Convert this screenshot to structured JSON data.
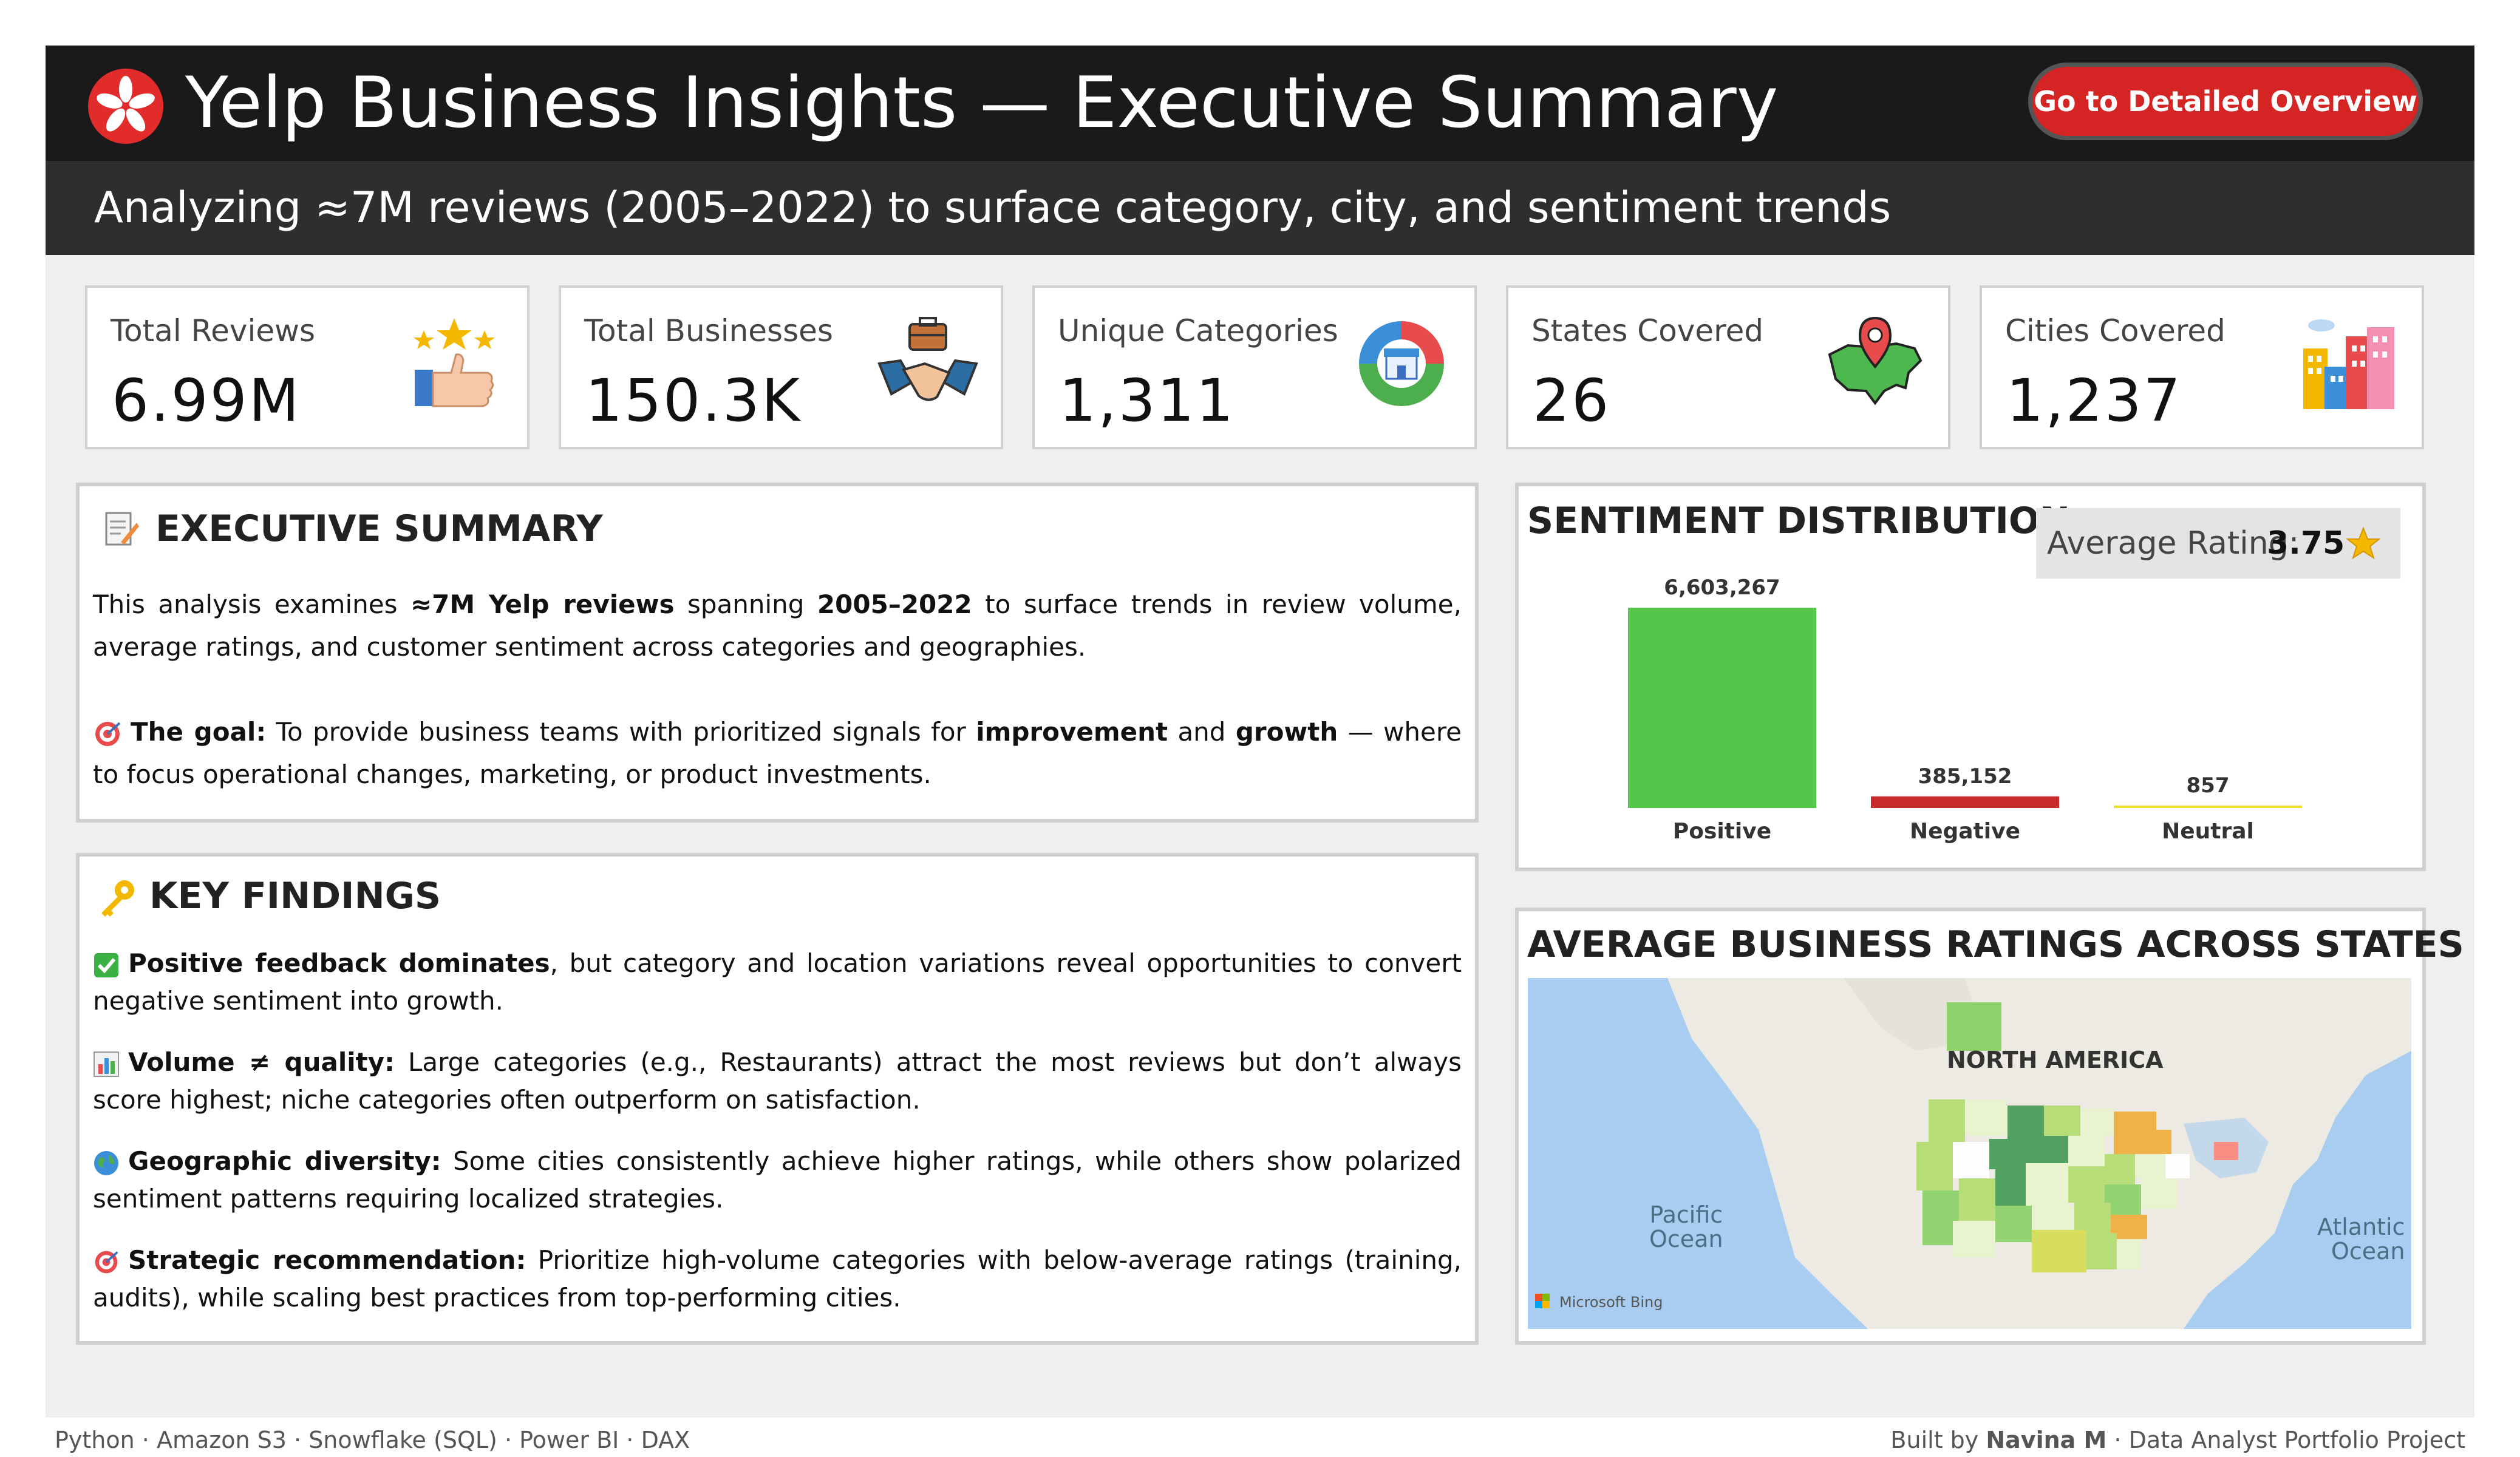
{
  "header": {
    "logo": "yelp-burst-logo",
    "title": "Yelp Business Insights — Executive Summary",
    "cta_label": "Go to Detailed Overview",
    "subtitle": "Analyzing ≈7M reviews (2005–2022) to surface category, city, and sentiment trends"
  },
  "kpis": [
    {
      "label": "Total Reviews",
      "value": "6.99M",
      "icon": "thumbs-up-stars-icon"
    },
    {
      "label": "Total Businesses",
      "value": "150.3K",
      "icon": "handshake-briefcase-icon"
    },
    {
      "label": "Unique Categories",
      "value": "1,311",
      "icon": "category-store-ring-icon"
    },
    {
      "label": "States Covered",
      "value": "26",
      "icon": "usa-map-pin-icon"
    },
    {
      "label": "Cities Covered",
      "value": "1,237",
      "icon": "city-buildings-icon"
    }
  ],
  "executive_summary": {
    "icon": "memo-pencil-icon",
    "title": "EXECUTIVE SUMMARY",
    "p1_a": "This analysis examines ",
    "p1_b": "≈7M Yelp reviews",
    "p1_c": " spanning ",
    "p1_d": "2005–2022",
    "p1_e": " to surface trends in review volume, average ratings, and customer sentiment across categories and geographies.",
    "goal_icon": "target-icon",
    "goal_label": "The goal:",
    "goal_a": " To provide business teams with prioritized signals for ",
    "goal_b": "improvement",
    "goal_c": " and ",
    "goal_d": "growth",
    "goal_e": " — where to focus operational changes, marketing, or product investments."
  },
  "key_findings": {
    "icon": "key-icon",
    "title": "KEY FINDINGS",
    "items": [
      {
        "icon": "check-icon",
        "bold": "Positive feedback dominates",
        "text": ", but category and location variations reveal opportunities to convert negative sentiment into growth."
      },
      {
        "icon": "bar-chart-icon",
        "bold": "Volume ≠ quality:",
        "text": " Large categories (e.g., Restaurants) attract the most reviews but don’t always score highest; niche categories often outperform on satisfaction."
      },
      {
        "icon": "globe-icon",
        "bold": "Geographic diversity:",
        "text": " Some cities consistently achieve higher ratings, while others show polarized sentiment patterns requiring localized strategies."
      },
      {
        "icon": "target-icon",
        "bold": "Strategic recommendation:",
        "text": " Prioritize high-volume categories with below-average ratings (training, audits), while scaling best practices from top-performing cities."
      }
    ]
  },
  "sentiment": {
    "title": "SENTIMENT DISTRIBUTION",
    "avg_label": "Average Rating:",
    "avg_value": "3.75",
    "avg_icon": "star-icon"
  },
  "chart_data": {
    "type": "bar",
    "title": "SENTIMENT DISTRIBUTION",
    "categories": [
      "Positive",
      "Negative",
      "Neutral"
    ],
    "values": [
      6603267,
      385152,
      857
    ],
    "value_labels": [
      "6,603,267",
      "385,152",
      "857"
    ],
    "colors": [
      "#56c64a",
      "#c92a2a",
      "#e8e02c"
    ],
    "xlabel": "",
    "ylabel": "",
    "grid": false
  },
  "map_panel": {
    "title": "AVERAGE BUSINESS RATINGS ACROSS STATES",
    "continent_label": "NORTH AMERICA",
    "ocean_left": "Pacific\nOcean",
    "ocean_right": "Atlantic\nOcean",
    "attribution": "Microsoft Bing",
    "attribution_icon": "microsoft-logo-icon"
  },
  "footer": {
    "tech_stack": "Python · Amazon S3 · Snowflake (SQL) · Power BI · DAX",
    "credit_prefix": "Built by ",
    "credit_name": "Navina M",
    "credit_suffix": " · Data Analyst Portfolio Project"
  }
}
